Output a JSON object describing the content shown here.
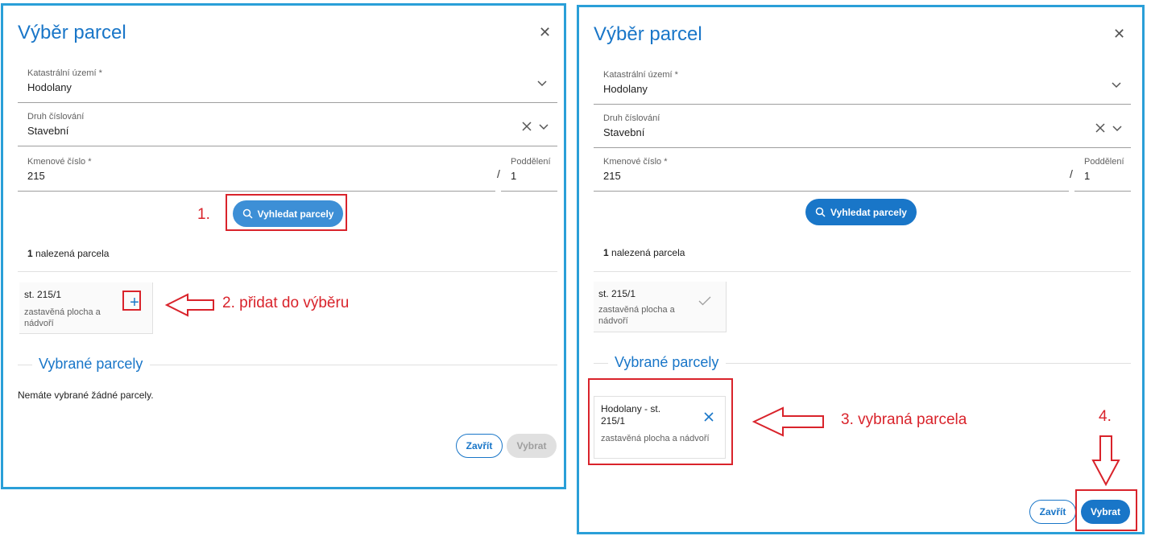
{
  "dialog1": {
    "title": "Výběr parcel",
    "field_cadastral_label": "Katastrální území *",
    "field_cadastral_value": "Hodolany",
    "field_numbering_label": "Druh číslování",
    "field_numbering_value": "Stavební",
    "field_number_label": "Kmenové číslo *",
    "field_number_value": "215",
    "separator": "/",
    "field_subdivision_label": "Poddělení",
    "field_subdivision_value": "1",
    "search_label": "Vyhledat parcely",
    "found_count": "1",
    "found_text": "nalezená parcela",
    "result_id": "st. 215/1",
    "result_desc": "zastavěná plocha a nádvoří",
    "selected_title": "Vybrané parcely",
    "empty_message": "Nemáte vybrané žádné parcely.",
    "close_label": "Zavřít",
    "select_label": "Vybrat"
  },
  "dialog2": {
    "title": "Výběr parcel",
    "field_cadastral_label": "Katastrální území *",
    "field_cadastral_value": "Hodolany",
    "field_numbering_label": "Druh číslování",
    "field_numbering_value": "Stavební",
    "field_number_label": "Kmenové číslo *",
    "field_number_value": "215",
    "separator": "/",
    "field_subdivision_label": "Poddělení",
    "field_subdivision_value": "1",
    "search_label": "Vyhledat parcely",
    "found_count": "1",
    "found_text": "nalezená parcela",
    "result_id": "st. 215/1",
    "result_desc": "zastavěná plocha a nádvoří",
    "selected_title": "Vybrané parcely",
    "selected_item_id": "Hodolany - st. 215/1",
    "selected_item_desc": "zastavěná plocha a nádvoří",
    "close_label": "Zavřít",
    "select_label": "Vybrat"
  },
  "annotations": {
    "step1": "1.",
    "step2": "2. přidat do výběru",
    "step3": "3. vybraná parcela",
    "step4": "4."
  },
  "colors": {
    "dialog_border": "#2a9fd8",
    "primary": "#1976c8",
    "annotation": "#d9232b",
    "disabled_bg": "#e0e0e0"
  },
  "icons": {
    "close": "close-icon",
    "dropdown": "chevron-down-icon",
    "clear": "clear-icon",
    "search": "search-icon",
    "add": "plus-icon",
    "added": "check-icon",
    "remove": "remove-icon",
    "arrow": "arrow-icon"
  }
}
